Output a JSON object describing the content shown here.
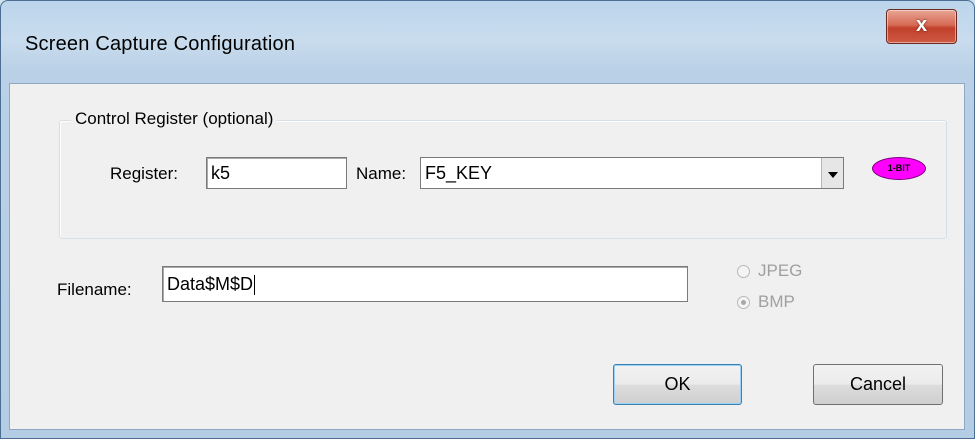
{
  "window": {
    "title": "Screen Capture Configuration",
    "close_label": "x"
  },
  "group": {
    "legend": "Control Register (optional)"
  },
  "register": {
    "label": "Register:",
    "value": "k5"
  },
  "name": {
    "label": "Name:",
    "value": "F5_KEY"
  },
  "badge": {
    "text": "1-BIT",
    "color": "#ff00ff"
  },
  "filename": {
    "label": "Filename:",
    "value": "Data$M$D"
  },
  "format": {
    "options": [
      {
        "label": "JPEG",
        "checked": false,
        "enabled": false
      },
      {
        "label": "BMP",
        "checked": true,
        "enabled": false
      }
    ]
  },
  "buttons": {
    "ok": "OK",
    "cancel": "Cancel"
  }
}
